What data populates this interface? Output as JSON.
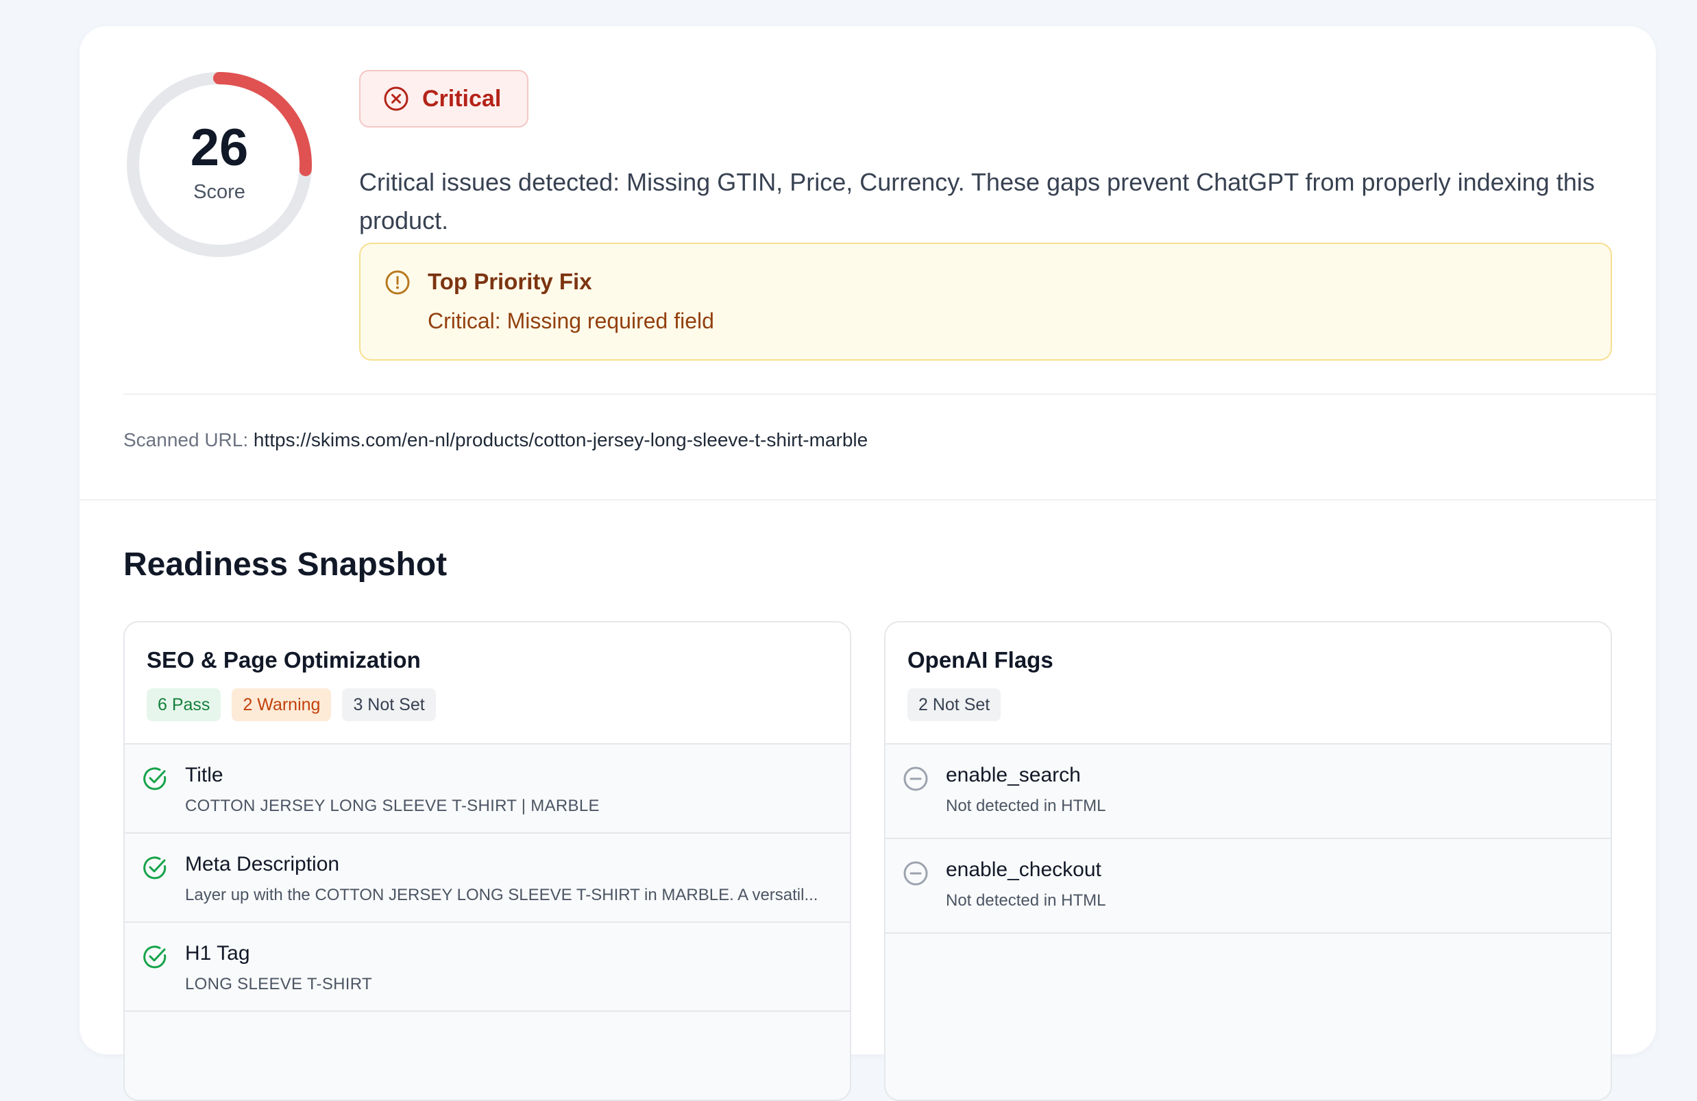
{
  "score": {
    "value": "26",
    "label": "Score",
    "fraction": 0.26,
    "color": "#e05252"
  },
  "status": {
    "label": "Critical",
    "icon": "x-circle-icon",
    "color": "#b42318"
  },
  "summary": "Critical issues detected: Missing GTIN, Price, Currency. These gaps prevent ChatGPT from properly indexing this product.",
  "priority_fix": {
    "icon": "alert-circle-icon",
    "title": "Top Priority Fix",
    "text": "Critical: Missing required field"
  },
  "scanned": {
    "label": "Scanned URL:",
    "url": "https://skims.com/en-nl/products/cotton-jersey-long-sleeve-t-shirt-marble"
  },
  "readiness": {
    "title": "Readiness Snapshot",
    "seo": {
      "title": "SEO & Page Optimization",
      "chips": {
        "pass": "6 Pass",
        "warning": "2 Warning",
        "not_set": "3 Not Set"
      },
      "items": [
        {
          "status": "pass",
          "icon": "check-circle-icon",
          "title": "Title",
          "value": "COTTON JERSEY LONG SLEEVE T-SHIRT | MARBLE"
        },
        {
          "status": "pass",
          "icon": "check-circle-icon",
          "title": "Meta Description",
          "value": "Layer up with the COTTON JERSEY LONG SLEEVE T-SHIRT in MARBLE. A versatil..."
        },
        {
          "status": "pass",
          "icon": "check-circle-icon",
          "title": "H1 Tag",
          "value": "LONG SLEEVE T-SHIRT"
        }
      ]
    },
    "openai": {
      "title": "OpenAI Flags",
      "chips": {
        "not_set": "2 Not Set"
      },
      "items": [
        {
          "status": "not_set",
          "icon": "minus-circle-icon",
          "title": "enable_search",
          "value": "Not detected in HTML"
        },
        {
          "status": "not_set",
          "icon": "minus-circle-icon",
          "title": "enable_checkout",
          "value": "Not detected in HTML"
        }
      ]
    }
  },
  "colors": {
    "pass": "#16a34a",
    "warning": "#c2410c",
    "not_set": "#6b7280",
    "critical": "#b42318",
    "ring_track": "#e5e7eb"
  }
}
